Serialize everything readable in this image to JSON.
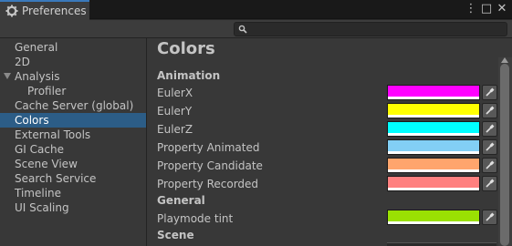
{
  "window": {
    "title": "Preferences",
    "menu_glyph": "⋮",
    "maximize_glyph": "□",
    "close_glyph": "✕"
  },
  "search": {
    "placeholder": "",
    "value": ""
  },
  "sidebar": {
    "items": [
      {
        "label": "General"
      },
      {
        "label": "2D"
      },
      {
        "label": "Analysis"
      },
      {
        "label": "Profiler"
      },
      {
        "label": "Cache Server (global)"
      },
      {
        "label": "Colors",
        "selected": true
      },
      {
        "label": "External Tools"
      },
      {
        "label": "GI Cache"
      },
      {
        "label": "Scene View"
      },
      {
        "label": "Search Service"
      },
      {
        "label": "Timeline"
      },
      {
        "label": "UI Scaling"
      }
    ]
  },
  "content": {
    "title": "Colors",
    "sections": [
      {
        "name": "Animation",
        "properties": [
          {
            "label": "EulerX",
            "color": "#ff00ff"
          },
          {
            "label": "EulerY",
            "color": "#ffff00"
          },
          {
            "label": "EulerZ",
            "color": "#00ffff"
          },
          {
            "label": "Property Animated",
            "color": "#82cff5"
          },
          {
            "label": "Property Candidate",
            "color": "#ffa56d"
          },
          {
            "label": "Property Recorded",
            "color": "#ff807f"
          }
        ]
      },
      {
        "name": "General",
        "properties": [
          {
            "label": "Playmode tint",
            "color": "#9ae003"
          }
        ]
      },
      {
        "name": "Scene",
        "properties": []
      }
    ]
  },
  "colors": {
    "selection": "#2c5d87",
    "active_tab_accent": "#3a79bb"
  }
}
